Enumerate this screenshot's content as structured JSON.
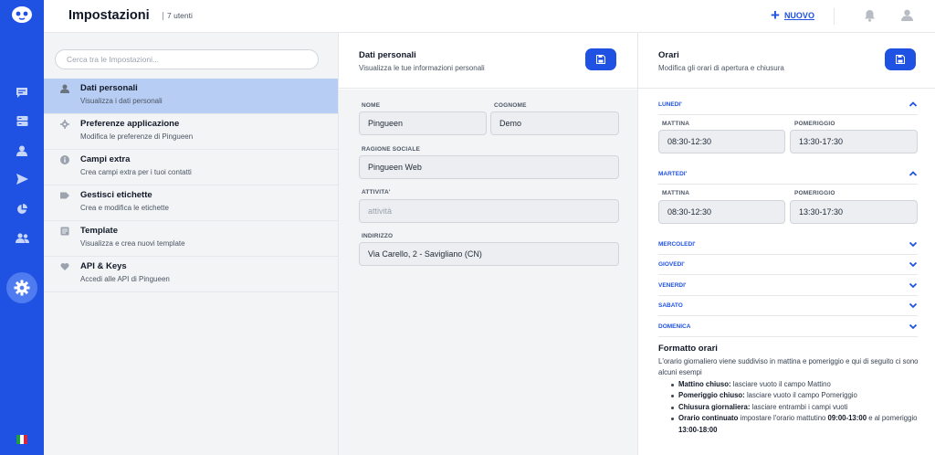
{
  "app": {
    "title": "Impostazioni",
    "user_count": "7 utenti",
    "new_label": "NUOVO"
  },
  "search": {
    "placeholder": "Cerca tra le Impostazioni..."
  },
  "menu": [
    {
      "title": "Dati personali",
      "desc": "Visualizza i dati personali"
    },
    {
      "title": "Preferenze applicazione",
      "desc": "Modifica le preferenze di Pingueen"
    },
    {
      "title": "Campi extra",
      "desc": "Crea campi extra per i tuoi contatti"
    },
    {
      "title": "Gestisci etichette",
      "desc": "Crea e modifica le etichette"
    },
    {
      "title": "Template",
      "desc": "Visualizza e crea nuovi template"
    },
    {
      "title": "API & Keys",
      "desc": "Accedi alle API di Pingueen"
    }
  ],
  "personal": {
    "title": "Dati personali",
    "subtitle": "Visualizza le tue informazioni personali",
    "nome_label": "NOME",
    "nome_value": "Pingueen",
    "cognome_label": "COGNOME",
    "cognome_value": "Demo",
    "ragione_label": "RAGIONE SOCIALE",
    "ragione_value": "Pingueen Web",
    "attivita_label": "ATTIVITA'",
    "attivita_placeholder": "attività",
    "indirizzo_label": "INDIRIZZO",
    "indirizzo_value": "Via Carello, 2 - Savigliano (CN)"
  },
  "orari": {
    "title": "Orari",
    "subtitle": "Modifica gli orari di apertura e chiusura",
    "mattina_label": "MATTINA",
    "pomeriggio_label": "POMERIGGIO",
    "days": [
      {
        "name": "LUNEDI'",
        "mattina": "08:30-12:30",
        "pomeriggio": "13:30-17:30"
      },
      {
        "name": "MARTEDI'",
        "mattina": "08:30-12:30",
        "pomeriggio": "13:30-17:30"
      },
      {
        "name": "MERCOLEDI'"
      },
      {
        "name": "GIOVEDI'"
      },
      {
        "name": "VENERDI'"
      },
      {
        "name": "SABATO"
      },
      {
        "name": "DOMENICA"
      }
    ],
    "format_title": "Formatto orari",
    "format_desc": "L'orario giornaliero viene suddiviso in mattina e pomeriggio e qui di seguito ci sono alcuni esempi",
    "examples": [
      {
        "bold": "Mattino chiuso:",
        "text": " lasciare vuoto il campo Mattino"
      },
      {
        "bold": "Pomeriggio chiuso:",
        "text": " lasciare vuoto il campo Pomeriggio"
      },
      {
        "bold": "Chiusura giornaliera:",
        "text": " lasciare entrambi i campi vuoti"
      },
      {
        "bold": "Orario continuato",
        "text": " impostare l'orario mattutino ",
        "b2": "09:00-13:00",
        "t2": " e al pomeriggio ",
        "b3": "13:00-18:00"
      }
    ]
  },
  "colors": {
    "primary": "#1f52e3",
    "active_bg": "#b7cdf3",
    "panel_bg": "#f3f4f6"
  },
  "icons": [
    "logo-icon",
    "chat-icon",
    "server-icon",
    "user-icon",
    "send-icon",
    "pie-chart-icon",
    "users-icon",
    "gear-icon",
    "bell-icon",
    "avatar-icon",
    "save-icon",
    "chevron-up-icon",
    "chevron-down-icon",
    "info-icon",
    "tag-icon",
    "template-icon",
    "heart-icon"
  ]
}
